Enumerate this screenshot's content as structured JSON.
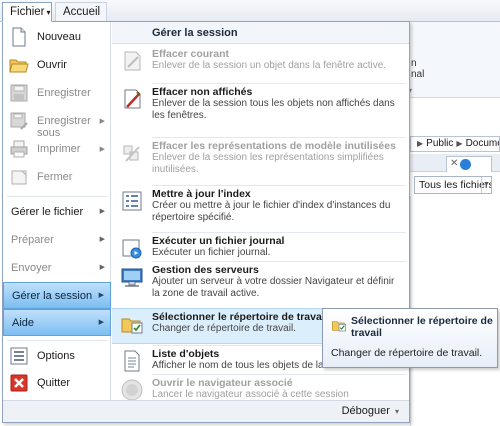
{
  "tabs": {
    "fichier": "Fichier",
    "accueil": "Accueil"
  },
  "background": {
    "ribbon_fragment": "n\nnal",
    "address_parts": [
      "Public",
      "Documents"
    ],
    "filter_value": "Tous les fichiers ("
  },
  "left_menu": {
    "primary": [
      {
        "label": "Nouveau",
        "icon": "new-document-icon",
        "enabled": true
      },
      {
        "label": "Ouvrir",
        "icon": "open-folder-icon",
        "enabled": true
      },
      {
        "label": "Enregistrer",
        "icon": "save-icon",
        "enabled": false
      },
      {
        "label": "Enregistrer sous",
        "icon": "save-as-icon",
        "enabled": false,
        "submenu": true
      },
      {
        "label": "Imprimer",
        "icon": "printer-icon",
        "enabled": false,
        "submenu": true
      },
      {
        "label": "Fermer",
        "icon": "close-document-icon",
        "enabled": false
      }
    ],
    "secondary": [
      {
        "label": "Gérer le fichier",
        "enabled": true
      },
      {
        "label": "Préparer",
        "enabled": false
      },
      {
        "label": "Envoyer",
        "enabled": false
      },
      {
        "label": "Gérer la session",
        "enabled": true,
        "active": true
      },
      {
        "label": "Aide",
        "enabled": true,
        "active": true
      }
    ],
    "bottom": [
      {
        "label": "Options",
        "icon": "options-icon"
      },
      {
        "label": "Quitter",
        "icon": "quit-icon"
      }
    ]
  },
  "session_panel": {
    "header": "Gérer la session",
    "items": [
      {
        "title": "Effacer courant",
        "desc": "Enlever de la session un objet dans la fenêtre active.",
        "enabled": false,
        "icon": "erase-current-icon"
      },
      {
        "title": "Effacer non affichés",
        "desc": "Enlever de la session tous les objets non affichés dans les fenêtres.",
        "enabled": true,
        "icon": "erase-hidden-icon"
      },
      {
        "title": "Effacer les représentations de modèle inutilisées",
        "desc": "Enlever de la session les représentations simplifiées inutilisées.",
        "enabled": false,
        "icon": "erase-representations-icon"
      },
      {
        "title": "Mettre à jour l'index",
        "desc": "Créer ou mettre à jour le fichier d'index d'instances du répertoire spécifié.",
        "enabled": true,
        "icon": "update-index-icon"
      },
      {
        "title": "Exécuter un fichier journal",
        "desc": "Exécuter un fichier journal.",
        "enabled": true,
        "icon": "run-trail-file-icon"
      },
      {
        "title": "Gestion des serveurs",
        "desc": "Ajouter un serveur à votre dossier Navigateur et définir la zone de travail active.",
        "enabled": true,
        "icon": "server-management-icon"
      },
      {
        "title": "Sélectionner le répertoire de travail",
        "desc": "Changer de répertoire de travail.",
        "enabled": true,
        "highlighted": true,
        "icon": "working-directory-icon"
      },
      {
        "title": "Liste d'objets",
        "desc": "Afficher le nom de tous les objets de la session",
        "enabled": true,
        "icon": "object-list-icon"
      },
      {
        "title": "Ouvrir le navigateur associé",
        "desc": "Lancer le navigateur associé à cette session Parametric.",
        "enabled": false,
        "icon": "open-browser-icon"
      }
    ]
  },
  "footer": {
    "debug_label": "Déboguer"
  },
  "tooltip": {
    "title": "Sélectionner le répertoire de travail",
    "desc": "Changer de répertoire de travail."
  }
}
